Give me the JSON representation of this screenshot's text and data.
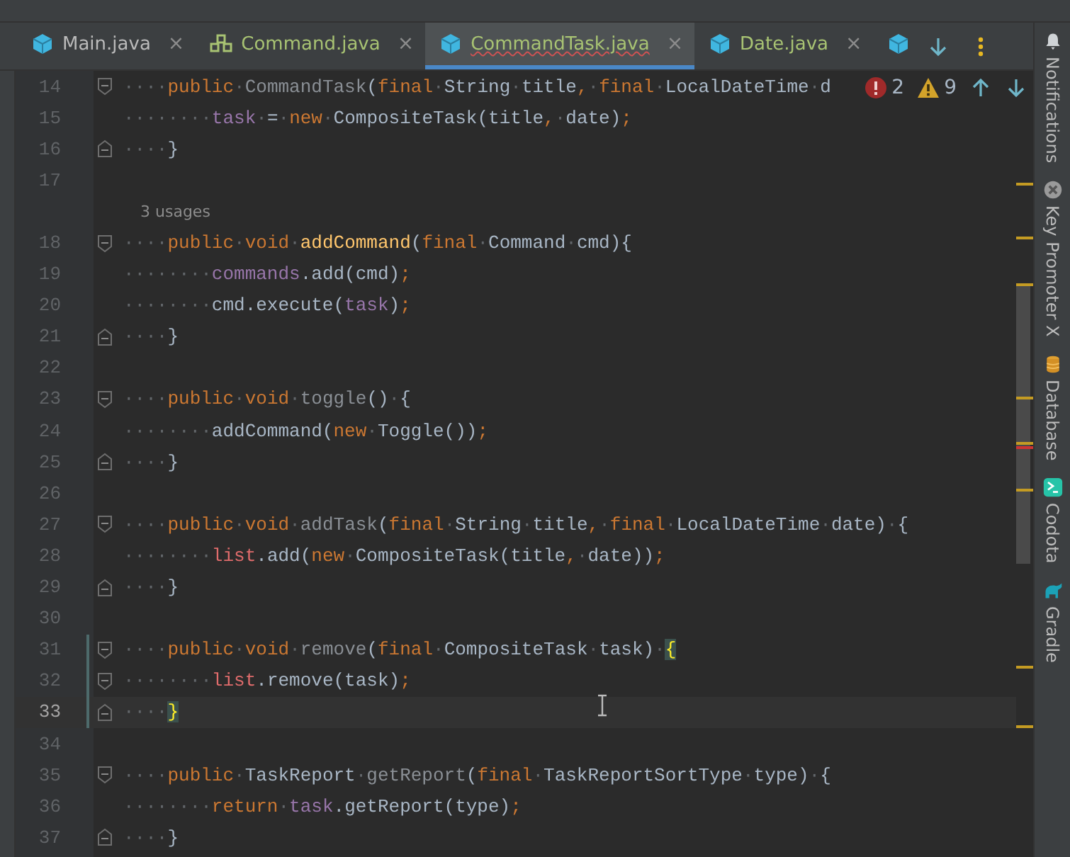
{
  "tabs": [
    {
      "label": "Main.java",
      "close": "×",
      "kind": "class",
      "color": "#bbbbbb",
      "selected": false,
      "error": false
    },
    {
      "label": "Command.java",
      "close": "×",
      "kind": "interface",
      "color": "#a8c373",
      "selected": false,
      "error": false
    },
    {
      "label": "CommandTask.java",
      "close": "×",
      "kind": "class",
      "color": "#a8c373",
      "selected": true,
      "error": true
    },
    {
      "label": "Date.java",
      "close": "×",
      "kind": "class",
      "color": "#a8c373",
      "selected": false,
      "error": false
    },
    {
      "kind": "class",
      "selected": false
    }
  ],
  "inspection": {
    "errors": "2",
    "warnings": "9"
  },
  "lines": [
    {
      "kind": "code",
      "number": "14",
      "fold_start": true,
      "tokens": [
        {
          "text": "····",
          "kind": "whitespace"
        },
        {
          "text": "public",
          "kind": "keyword"
        },
        {
          "text": "·",
          "kind": "whitespace"
        },
        {
          "text": "CommandTask",
          "kind": "unused"
        },
        {
          "text": "(",
          "kind": "plain"
        },
        {
          "text": "final",
          "kind": "keyword"
        },
        {
          "text": "·",
          "kind": "whitespace"
        },
        {
          "text": "String",
          "kind": "plain"
        },
        {
          "text": "·",
          "kind": "whitespace"
        },
        {
          "text": "title",
          "kind": "plain"
        },
        {
          "text": ",",
          "kind": "keyword"
        },
        {
          "text": "·",
          "kind": "whitespace"
        },
        {
          "text": "final",
          "kind": "keyword"
        },
        {
          "text": "·",
          "kind": "whitespace"
        },
        {
          "text": "LocalDateTime",
          "kind": "plain"
        },
        {
          "text": "·",
          "kind": "whitespace"
        },
        {
          "text": "d",
          "kind": "plain"
        }
      ]
    },
    {
      "kind": "code",
      "number": "15",
      "tokens": [
        {
          "text": "········",
          "kind": "whitespace"
        },
        {
          "text": "task",
          "kind": "field"
        },
        {
          "text": "·",
          "kind": "whitespace"
        },
        {
          "text": "=",
          "kind": "plain"
        },
        {
          "text": "·",
          "kind": "whitespace"
        },
        {
          "text": "new",
          "kind": "keyword"
        },
        {
          "text": "·",
          "kind": "whitespace"
        },
        {
          "text": "CompositeTask(title",
          "kind": "plain"
        },
        {
          "text": ",",
          "kind": "keyword"
        },
        {
          "text": "·",
          "kind": "whitespace"
        },
        {
          "text": "date)",
          "kind": "plain"
        },
        {
          "text": ";",
          "kind": "keyword"
        }
      ]
    },
    {
      "kind": "code",
      "number": "16",
      "fold_end": true,
      "tokens": [
        {
          "text": "····",
          "kind": "whitespace"
        },
        {
          "text": "}",
          "kind": "plain"
        }
      ]
    },
    {
      "kind": "code",
      "number": "17"
    },
    {
      "kind": "inlay",
      "text": "3 usages"
    },
    {
      "kind": "code",
      "number": "18",
      "fold_start": true,
      "tokens": [
        {
          "text": "····",
          "kind": "whitespace"
        },
        {
          "text": "public",
          "kind": "keyword"
        },
        {
          "text": "·",
          "kind": "whitespace"
        },
        {
          "text": "void",
          "kind": "keyword"
        },
        {
          "text": "·",
          "kind": "whitespace"
        },
        {
          "text": "addCommand",
          "kind": "declaration"
        },
        {
          "text": "(",
          "kind": "plain"
        },
        {
          "text": "final",
          "kind": "keyword"
        },
        {
          "text": "·",
          "kind": "whitespace"
        },
        {
          "text": "Command",
          "kind": "plain"
        },
        {
          "text": "·",
          "kind": "whitespace"
        },
        {
          "text": "cmd){",
          "kind": "plain"
        }
      ]
    },
    {
      "kind": "code",
      "number": "19",
      "tokens": [
        {
          "text": "········",
          "kind": "whitespace"
        },
        {
          "text": "commands",
          "kind": "field"
        },
        {
          "text": ".add(cmd)",
          "kind": "plain"
        },
        {
          "text": ";",
          "kind": "keyword"
        }
      ]
    },
    {
      "kind": "code",
      "number": "20",
      "tokens": [
        {
          "text": "········",
          "kind": "whitespace"
        },
        {
          "text": "cmd.execute(",
          "kind": "plain"
        },
        {
          "text": "task",
          "kind": "field"
        },
        {
          "text": ")",
          "kind": "plain"
        },
        {
          "text": ";",
          "kind": "keyword"
        }
      ]
    },
    {
      "kind": "code",
      "number": "21",
      "fold_end": true,
      "tokens": [
        {
          "text": "····",
          "kind": "whitespace"
        },
        {
          "text": "}",
          "kind": "plain"
        }
      ]
    },
    {
      "kind": "code",
      "number": "22"
    },
    {
      "kind": "code",
      "number": "23",
      "fold_start": true,
      "tokens": [
        {
          "text": "····",
          "kind": "whitespace"
        },
        {
          "text": "public",
          "kind": "keyword"
        },
        {
          "text": "·",
          "kind": "whitespace"
        },
        {
          "text": "void",
          "kind": "keyword"
        },
        {
          "text": "·",
          "kind": "whitespace"
        },
        {
          "text": "toggle",
          "kind": "unused"
        },
        {
          "text": "()",
          "kind": "plain"
        },
        {
          "text": "·",
          "kind": "whitespace"
        },
        {
          "text": "{",
          "kind": "plain"
        }
      ]
    },
    {
      "kind": "code",
      "number": "24",
      "tokens": [
        {
          "text": "········",
          "kind": "whitespace"
        },
        {
          "text": "addCommand(",
          "kind": "plain"
        },
        {
          "text": "new",
          "kind": "keyword"
        },
        {
          "text": "·",
          "kind": "whitespace"
        },
        {
          "text": "Toggle())",
          "kind": "plain"
        },
        {
          "text": ";",
          "kind": "keyword"
        }
      ]
    },
    {
      "kind": "code",
      "number": "25",
      "fold_end": true,
      "tokens": [
        {
          "text": "····",
          "kind": "whitespace"
        },
        {
          "text": "}",
          "kind": "plain"
        }
      ]
    },
    {
      "kind": "code",
      "number": "26"
    },
    {
      "kind": "code",
      "number": "27",
      "fold_start": true,
      "tokens": [
        {
          "text": "····",
          "kind": "whitespace"
        },
        {
          "text": "public",
          "kind": "keyword"
        },
        {
          "text": "·",
          "kind": "whitespace"
        },
        {
          "text": "void",
          "kind": "keyword"
        },
        {
          "text": "·",
          "kind": "whitespace"
        },
        {
          "text": "addTask",
          "kind": "unused"
        },
        {
          "text": "(",
          "kind": "plain"
        },
        {
          "text": "final",
          "kind": "keyword"
        },
        {
          "text": "·",
          "kind": "whitespace"
        },
        {
          "text": "String",
          "kind": "plain"
        },
        {
          "text": "·",
          "kind": "whitespace"
        },
        {
          "text": "title",
          "kind": "plain"
        },
        {
          "text": ",",
          "kind": "keyword"
        },
        {
          "text": "·",
          "kind": "whitespace"
        },
        {
          "text": "final",
          "kind": "keyword"
        },
        {
          "text": "·",
          "kind": "whitespace"
        },
        {
          "text": "LocalDateTime",
          "kind": "plain"
        },
        {
          "text": "·",
          "kind": "whitespace"
        },
        {
          "text": "date)",
          "kind": "plain"
        },
        {
          "text": "·",
          "kind": "whitespace"
        },
        {
          "text": "{",
          "kind": "plain"
        }
      ]
    },
    {
      "kind": "code",
      "number": "28",
      "tokens": [
        {
          "text": "········",
          "kind": "whitespace"
        },
        {
          "text": "list",
          "kind": "error"
        },
        {
          "text": ".add(",
          "kind": "plain"
        },
        {
          "text": "new",
          "kind": "keyword"
        },
        {
          "text": "·",
          "kind": "whitespace"
        },
        {
          "text": "CompositeTask(title",
          "kind": "plain"
        },
        {
          "text": ",",
          "kind": "keyword"
        },
        {
          "text": "·",
          "kind": "whitespace"
        },
        {
          "text": "date))",
          "kind": "plain"
        },
        {
          "text": ";",
          "kind": "keyword"
        }
      ]
    },
    {
      "kind": "code",
      "number": "29",
      "fold_end": true,
      "tokens": [
        {
          "text": "····",
          "kind": "whitespace"
        },
        {
          "text": "}",
          "kind": "plain"
        }
      ]
    },
    {
      "kind": "code",
      "number": "30"
    },
    {
      "kind": "code",
      "number": "31",
      "fold_start": true,
      "changed": true,
      "tokens": [
        {
          "text": "····",
          "kind": "whitespace"
        },
        {
          "text": "public",
          "kind": "keyword"
        },
        {
          "text": "·",
          "kind": "whitespace"
        },
        {
          "text": "void",
          "kind": "keyword"
        },
        {
          "text": "·",
          "kind": "whitespace"
        },
        {
          "text": "remove",
          "kind": "unused"
        },
        {
          "text": "(",
          "kind": "plain"
        },
        {
          "text": "final",
          "kind": "keyword"
        },
        {
          "text": "·",
          "kind": "whitespace"
        },
        {
          "text": "CompositeTask",
          "kind": "plain"
        },
        {
          "text": "·",
          "kind": "whitespace"
        },
        {
          "text": "task)",
          "kind": "plain"
        },
        {
          "text": "·",
          "kind": "whitespace"
        },
        {
          "text": "{",
          "kind": "brace_match"
        }
      ]
    },
    {
      "kind": "code",
      "number": "32",
      "fold_start": true,
      "changed": true,
      "tokens": [
        {
          "text": "········",
          "kind": "whitespace"
        },
        {
          "text": "list",
          "kind": "error"
        },
        {
          "text": ".remove(task)",
          "kind": "plain"
        },
        {
          "text": ";",
          "kind": "keyword"
        }
      ]
    },
    {
      "kind": "code",
      "number": "33",
      "fold_end": true,
      "changed": true,
      "current": true,
      "tokens": [
        {
          "text": "····",
          "kind": "whitespace"
        },
        {
          "text": "}",
          "kind": "brace_match"
        }
      ]
    },
    {
      "kind": "code",
      "number": "34"
    },
    {
      "kind": "code",
      "number": "35",
      "fold_start": true,
      "tokens": [
        {
          "text": "····",
          "kind": "whitespace"
        },
        {
          "text": "public",
          "kind": "keyword"
        },
        {
          "text": "·",
          "kind": "whitespace"
        },
        {
          "text": "TaskReport",
          "kind": "plain"
        },
        {
          "text": "·",
          "kind": "whitespace"
        },
        {
          "text": "getReport",
          "kind": "unused"
        },
        {
          "text": "(",
          "kind": "plain"
        },
        {
          "text": "final",
          "kind": "keyword"
        },
        {
          "text": "·",
          "kind": "whitespace"
        },
        {
          "text": "TaskReportSortType",
          "kind": "plain"
        },
        {
          "text": "·",
          "kind": "whitespace"
        },
        {
          "text": "type)",
          "kind": "plain"
        },
        {
          "text": "·",
          "kind": "whitespace"
        },
        {
          "text": "{",
          "kind": "plain"
        }
      ]
    },
    {
      "kind": "code",
      "number": "36",
      "tokens": [
        {
          "text": "········",
          "kind": "whitespace"
        },
        {
          "text": "return",
          "kind": "keyword"
        },
        {
          "text": "·",
          "kind": "whitespace"
        },
        {
          "text": "task",
          "kind": "field"
        },
        {
          "text": ".getReport(type)",
          "kind": "plain"
        },
        {
          "text": ";",
          "kind": "keyword"
        }
      ]
    },
    {
      "kind": "code",
      "number": "37",
      "fold_end": true,
      "tokens": [
        {
          "text": "····",
          "kind": "whitespace"
        },
        {
          "text": "}",
          "kind": "plain"
        }
      ]
    }
  ],
  "tool_windows": [
    {
      "label": "Notifications"
    },
    {
      "label": "Key Promoter X"
    },
    {
      "label": "Database"
    },
    {
      "label": "Codota"
    },
    {
      "label": "Gradle"
    }
  ]
}
